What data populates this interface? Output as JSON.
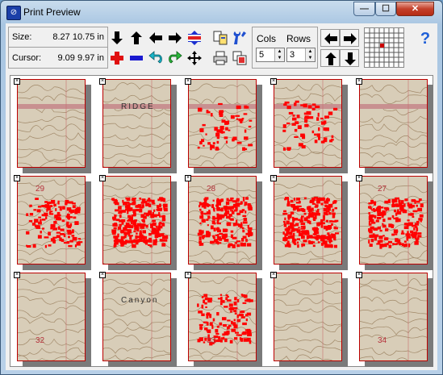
{
  "window": {
    "title": "Print Preview",
    "min_label": "—",
    "max_label": "☐",
    "close_label": "✕"
  },
  "info": {
    "size_label": "Size:",
    "size_value": "8.27 10.75 in",
    "cursor_label": "Cursor:",
    "cursor_value": "9.09 9.97 in"
  },
  "layout": {
    "cols_label": "Cols",
    "rows_label": "Rows",
    "cols_value": "5",
    "rows_value": "3"
  },
  "help_label": "?",
  "pages": [
    {
      "label": ""
    },
    {
      "label": "RIDGE"
    },
    {
      "label": ""
    },
    {
      "label": ""
    },
    {
      "label": ""
    },
    {
      "label": "29"
    },
    {
      "label": ""
    },
    {
      "label": "28"
    },
    {
      "label": ""
    },
    {
      "label": "27"
    },
    {
      "label": "32"
    },
    {
      "label": "Canyon"
    },
    {
      "label": "33"
    },
    {
      "label": ""
    },
    {
      "label": "34"
    }
  ],
  "colors": {
    "map_bg": "#d8cdb8",
    "track": "#ff0000",
    "page_border": "#bb0000"
  }
}
